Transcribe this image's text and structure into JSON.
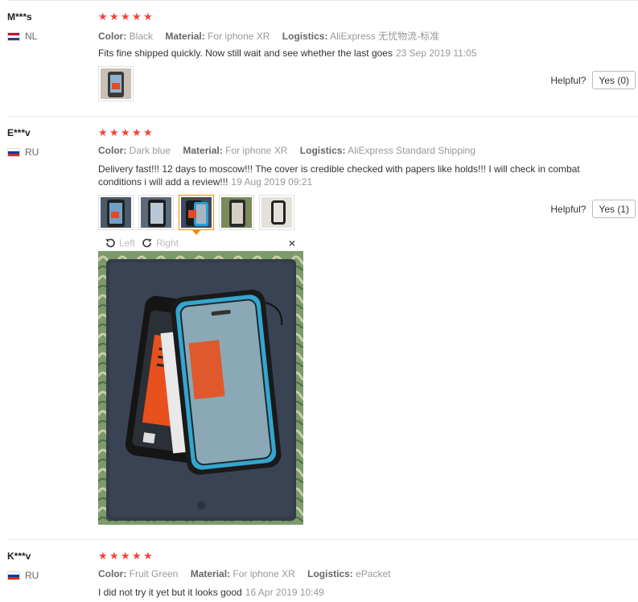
{
  "labels": {
    "color": "Color:",
    "material": "Material:",
    "logistics": "Logistics:",
    "helpful": "Helpful?"
  },
  "colors": {
    "star": "#f44336",
    "accent": "#f08a00"
  },
  "reviews": [
    {
      "user": "M***s",
      "country": "NL",
      "rating": 5,
      "color": "Black",
      "material": "For iphone XR",
      "logistics": "AliExpress 无忧物流-标准",
      "feedback": "Fits fine shipped quickly. Now still wait and see whether the last goes",
      "date": "23 Sep 2019 11:05",
      "helpful_button": "Yes (0)"
    },
    {
      "user": "E***v",
      "country": "RU",
      "rating": 5,
      "color": "Dark blue",
      "material": "For iphone XR",
      "logistics": "AliExpress Standard Shipping",
      "feedback": "Delivery fast!!! 12 days to moscow!!! The cover is credible checked with papers like holds!!! I will check in combat conditions i will add a review!!!",
      "date": "19 Aug 2019 09:21",
      "helpful_button": "Yes (1)",
      "viewer": {
        "rotate_left": "Left",
        "rotate_right": "Right",
        "close": "×"
      }
    },
    {
      "user": "K***v",
      "country": "RU",
      "rating": 5,
      "color": "Fruit Green",
      "material": "For iphone XR",
      "logistics": "ePacket",
      "feedback": "I did not try it yet but it looks good",
      "date": "16 Apr 2019 10:49"
    }
  ]
}
